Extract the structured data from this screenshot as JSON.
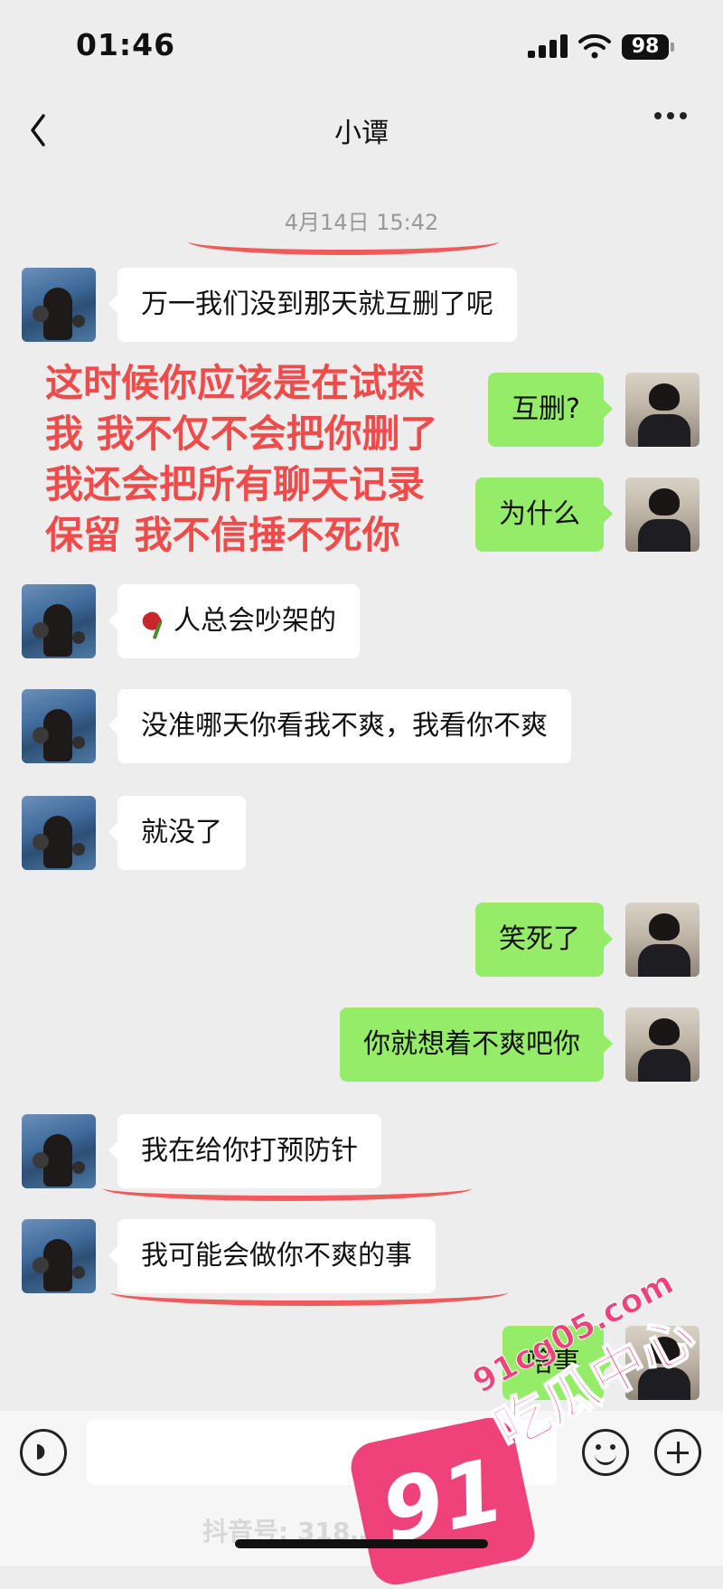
{
  "status": {
    "time": "01:46",
    "battery": "98"
  },
  "nav": {
    "title": "小谭"
  },
  "chat": {
    "timestamp": "4月14日 15:42",
    "messages": [
      {
        "from": "her",
        "text": "万一我们没到那天就互删了呢"
      },
      {
        "from": "me",
        "text": "互删?"
      },
      {
        "from": "me",
        "text": "为什么"
      },
      {
        "from": "her",
        "text": "人总会吵架的",
        "emoji": "wilted-rose"
      },
      {
        "from": "her",
        "text": "没准哪天你看我不爽，我看你不爽"
      },
      {
        "from": "her",
        "text": "就没了"
      },
      {
        "from": "me",
        "text": "笑死了"
      },
      {
        "from": "me",
        "text": "你就想着不爽吧你"
      },
      {
        "from": "her",
        "text": "我在给你打预防针"
      },
      {
        "from": "her",
        "text": "我可能会做你不爽的事"
      },
      {
        "from": "me",
        "text": "啥事"
      }
    ]
  },
  "annotation": {
    "color": "#ef4b4b",
    "lines": [
      "这时候你应该是在试探",
      "我 我不仅不会把你删了",
      "我还会把所有聊天记录",
      "保留 我不信捶不死你"
    ]
  },
  "watermark": {
    "badge": "91",
    "url": "91cg05.com",
    "name": "吃瓜中心",
    "douyin": "抖音号: 318… …87"
  },
  "colors": {
    "outgoing": "#95ec69",
    "incoming": "#ffffff",
    "background": "#ededed"
  }
}
